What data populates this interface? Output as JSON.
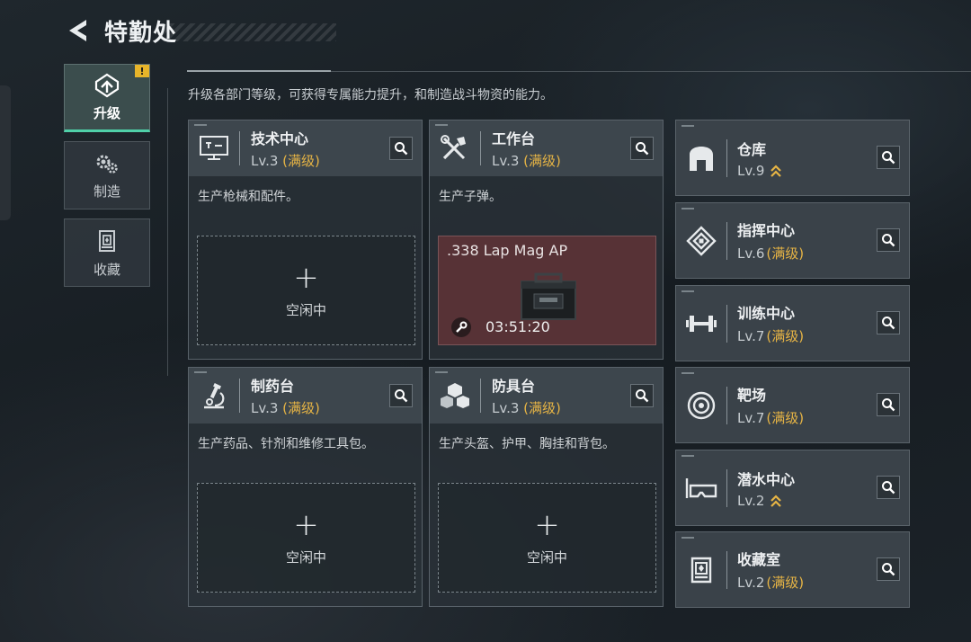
{
  "header": {
    "title": "特勤处"
  },
  "description": "升级各部门等级，可获得专属能力提升，和制造战斗物资的能力。",
  "nav": {
    "items": [
      {
        "label": "升级",
        "active": true,
        "badge": "!"
      },
      {
        "label": "制造",
        "active": false
      },
      {
        "label": "收藏",
        "active": false
      }
    ]
  },
  "cards": [
    {
      "name": "技术中心",
      "level": "Lv.3",
      "max": "(满级)",
      "desc": "生产枪械和配件。",
      "slot": {
        "state": "idle",
        "plus": "+",
        "label": "空闲中"
      }
    },
    {
      "name": "工作台",
      "level": "Lv.3",
      "max": "(满级)",
      "desc": "生产子弹。",
      "slot": {
        "state": "producing",
        "item": ".338 Lap Mag AP",
        "timer": "03:51:20"
      }
    },
    {
      "name": "制药台",
      "level": "Lv.3",
      "max": "(满级)",
      "desc": "生产药品、针剂和维修工具包。",
      "slot": {
        "state": "idle",
        "plus": "+",
        "label": "空闲中"
      }
    },
    {
      "name": "防具台",
      "level": "Lv.3",
      "max": "(满级)",
      "desc": "生产头盔、护甲、胸挂和背包。",
      "slot": {
        "state": "idle",
        "plus": "+",
        "label": "空闲中"
      }
    }
  ],
  "side_cards": [
    {
      "name": "仓库",
      "level": "Lv.9",
      "max": "",
      "upgradable": true,
      "icon": "warehouse-icon"
    },
    {
      "name": "指挥中心",
      "level": "Lv.6",
      "max": "(满级)",
      "upgradable": false,
      "icon": "command-center-icon"
    },
    {
      "name": "训练中心",
      "level": "Lv.7",
      "max": "(满级)",
      "upgradable": false,
      "icon": "dumbbell-icon"
    },
    {
      "name": "靶场",
      "level": "Lv.7",
      "max": "(满级)",
      "upgradable": false,
      "icon": "target-icon"
    },
    {
      "name": "潜水中心",
      "level": "Lv.2",
      "max": "",
      "upgradable": true,
      "icon": "diving-mask-icon"
    },
    {
      "name": "收藏室",
      "level": "Lv.2",
      "max": "(满级)",
      "upgradable": false,
      "icon": "collection-icon"
    }
  ],
  "colors": {
    "accent": "#4fd0a8",
    "max_level": "#e6b445",
    "warning": "#e8b52a",
    "producing_bg": "#573236"
  }
}
